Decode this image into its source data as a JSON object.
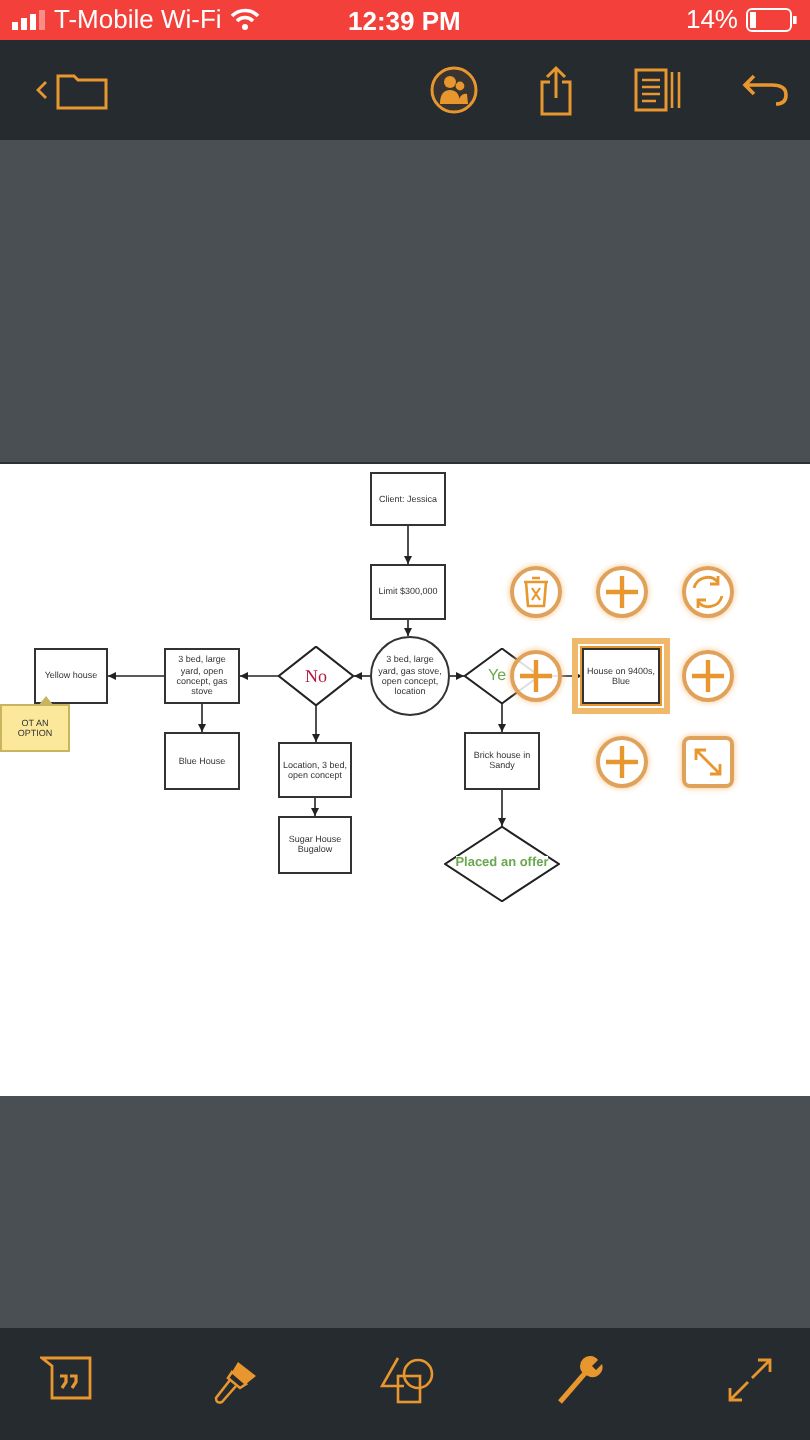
{
  "status_bar": {
    "carrier": "T-Mobile Wi-Fi",
    "time": "12:39 PM",
    "battery": "14%"
  },
  "diagram": {
    "nodes": [
      {
        "kind": "rect",
        "label": "Client: Jessica",
        "selected": false
      },
      {
        "kind": "rect",
        "label": "Limit $300,000",
        "selected": false
      },
      {
        "kind": "rect",
        "label": "Yellow house",
        "selected": false
      },
      {
        "kind": "rect",
        "label": "3 bed, large yard, open concept, gas stove",
        "selected": false
      },
      {
        "kind": "diamond",
        "label": "No",
        "color": "#b3193f",
        "selected": false
      },
      {
        "kind": "circle",
        "label": "3 bed, large yard, gas stove, open concept, location",
        "selected": false
      },
      {
        "kind": "diamond",
        "label": "Ye",
        "color": "#6aa84f",
        "selected": false
      },
      {
        "kind": "rect",
        "label": "House on 9400s, Blue",
        "selected": true
      },
      {
        "kind": "note",
        "label": "OT AN OPTION",
        "selected": false
      },
      {
        "kind": "rect",
        "label": "Blue House",
        "selected": false
      },
      {
        "kind": "rect",
        "label": "Location, 3 bed, open concept",
        "selected": false
      },
      {
        "kind": "rect",
        "label": "Brick house in Sandy",
        "selected": false
      },
      {
        "kind": "rect",
        "label": "Sugar House Bugalow",
        "selected": false
      },
      {
        "kind": "diamond",
        "label": "Placed an offer",
        "color": "#6aa84f",
        "selected": false
      }
    ],
    "handles": [
      {
        "kind": "delete"
      },
      {
        "kind": "add"
      },
      {
        "kind": "rotate"
      },
      {
        "kind": "add"
      },
      {
        "kind": "add"
      },
      {
        "kind": "add"
      },
      {
        "kind": "resize"
      }
    ]
  }
}
